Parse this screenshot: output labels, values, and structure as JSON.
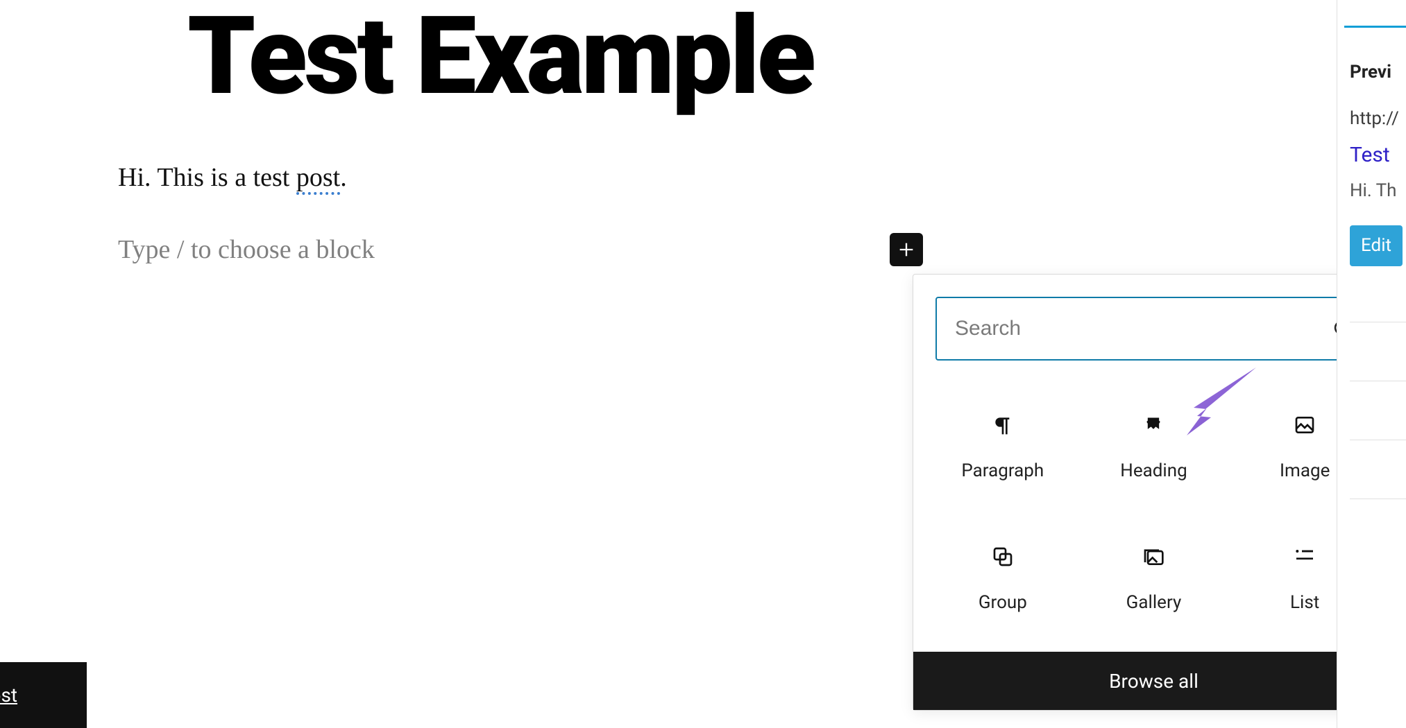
{
  "post": {
    "title": "Test Example",
    "body": "Hi. This is a test ",
    "body_spelled": "post",
    "body_tail": ".",
    "placeholder": "Type / to choose a block"
  },
  "inserter": {
    "search_placeholder": "Search",
    "blocks": [
      {
        "id": "paragraph",
        "label": "Paragraph"
      },
      {
        "id": "heading",
        "label": "Heading"
      },
      {
        "id": "image",
        "label": "Image"
      },
      {
        "id": "group",
        "label": "Group"
      },
      {
        "id": "gallery",
        "label": "Gallery"
      },
      {
        "id": "list",
        "label": "List"
      }
    ],
    "browse_all": "Browse all"
  },
  "sidebar": {
    "preview_heading": "Previ",
    "url": "http://",
    "title": "Test ",
    "snippet": "Hi. Th",
    "edit": "Edit"
  },
  "footer": {
    "draft_button": "w Post"
  },
  "colors": {
    "accent": "#0f7ba8",
    "link": "#2f21c7",
    "button": "#2ea3d8",
    "annotation": "#8a5fd6"
  }
}
